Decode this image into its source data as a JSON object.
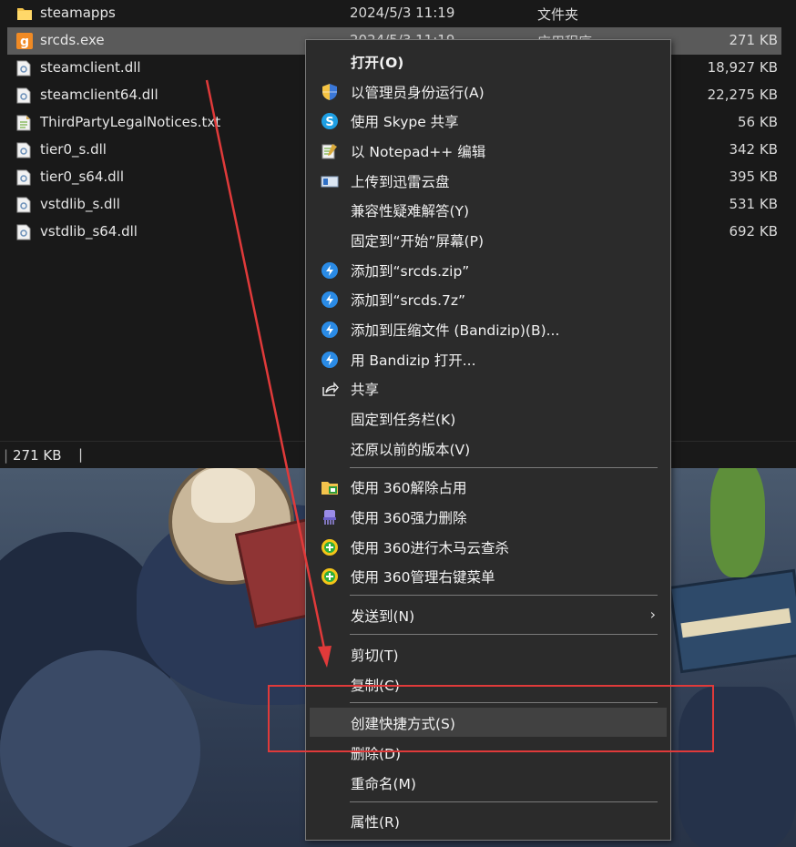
{
  "files": [
    {
      "name": "steamapps",
      "date": "2024/5/3 11:19",
      "type": "文件夹",
      "size": "",
      "icon": "folder-icon",
      "selected": false
    },
    {
      "name": "srcds.exe",
      "date": "2024/5/3 11:19",
      "type": "应用程序",
      "size": "271 KB",
      "icon": "gmod-app-icon",
      "selected": true
    },
    {
      "name": "steamclient.dll",
      "date": "",
      "type": "",
      "size": "18,927 KB",
      "icon": "dll-file-icon",
      "selected": false
    },
    {
      "name": "steamclient64.dll",
      "date": "",
      "type": "",
      "size": "22,275 KB",
      "icon": "dll-file-icon",
      "selected": false
    },
    {
      "name": "ThirdPartyLegalNotices.txt",
      "date": "",
      "type": "",
      "size": "56 KB",
      "icon": "text-file-icon",
      "selected": false
    },
    {
      "name": "tier0_s.dll",
      "date": "",
      "type": "",
      "size": "342 KB",
      "icon": "dll-file-icon",
      "selected": false
    },
    {
      "name": "tier0_s64.dll",
      "date": "",
      "type": "",
      "size": "395 KB",
      "icon": "dll-file-icon",
      "selected": false
    },
    {
      "name": "vstdlib_s.dll",
      "date": "",
      "type": "",
      "size": "531 KB",
      "icon": "dll-file-icon",
      "selected": false
    },
    {
      "name": "vstdlib_s64.dll",
      "date": "",
      "type": "",
      "size": "692 KB",
      "icon": "dll-file-icon",
      "selected": false
    }
  ],
  "status": {
    "selected_size": "271 KB",
    "separator": "|",
    "caret": "|"
  },
  "menu": {
    "items": [
      {
        "label": "打开(O)",
        "icon": "",
        "bold": true
      },
      {
        "label": "以管理员身份运行(A)",
        "icon": "uac-shield-icon"
      },
      {
        "label": "使用 Skype 共享",
        "icon": "skype-icon"
      },
      {
        "label": "以 Notepad++ 编辑",
        "icon": "notepad-plus-plus-icon"
      },
      {
        "label": "上传到迅雷云盘",
        "icon": "xunlei-cloud-icon"
      },
      {
        "label": "兼容性疑难解答(Y)",
        "icon": ""
      },
      {
        "label": "固定到“开始”屏幕(P)",
        "icon": ""
      },
      {
        "label": "添加到“srcds.zip”",
        "icon": "bandizip-icon"
      },
      {
        "label": "添加到“srcds.7z”",
        "icon": "bandizip-icon"
      },
      {
        "label": "添加到压缩文件 (Bandizip)(B)...",
        "icon": "bandizip-icon"
      },
      {
        "label": "用 Bandizip 打开...",
        "icon": "bandizip-icon"
      },
      {
        "label": "共享",
        "icon": "share-icon"
      },
      {
        "label": "固定到任务栏(K)",
        "icon": ""
      },
      {
        "label": "还原以前的版本(V)",
        "icon": ""
      },
      {
        "label": "使用 360解除占用",
        "icon": "unlock-file-360-icon"
      },
      {
        "label": "使用 360强力删除",
        "icon": "shred-360-icon"
      },
      {
        "label": "使用 360进行木马云查杀",
        "icon": "scan-360-icon"
      },
      {
        "label": "使用 360管理右键菜单",
        "icon": "menu-manager-360-icon"
      },
      {
        "label": "发送到(N)",
        "icon": "",
        "submenu": true
      },
      {
        "label": "剪切(T)",
        "icon": ""
      },
      {
        "label": "复制(C)",
        "icon": ""
      },
      {
        "label": "创建快捷方式(S)",
        "icon": "",
        "hover": true
      },
      {
        "label": "删除(D)",
        "icon": ""
      },
      {
        "label": "重命名(M)",
        "icon": ""
      },
      {
        "label": "属性(R)",
        "icon": ""
      }
    ],
    "submenu_arrow": "›"
  },
  "colors": {
    "annotation": "#e03a3a",
    "menu_bg": "#2b2b2b",
    "hover_bg": "#414141",
    "selected_row": "#5a5a5a"
  }
}
